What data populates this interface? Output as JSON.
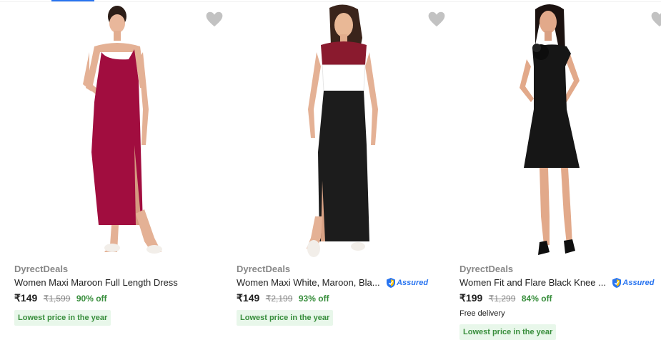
{
  "colors": {
    "accent": "#2874f0",
    "discount": "#388e3c",
    "badge_bg": "#e8f7ea",
    "wishlist": "#c2c2c2"
  },
  "products": [
    {
      "brand": "DyrectDeals",
      "title": "Women Maxi Maroon Full Length Dress",
      "assured": false,
      "price": "₹149",
      "mrp": "₹1,599",
      "discount": "90% off",
      "delivery": "",
      "badge": "Lowest price in the year",
      "wishlist_icon": "heart-icon"
    },
    {
      "brand": "DyrectDeals",
      "title": "Women Maxi White, Maroon, Bla...",
      "assured": true,
      "assured_label": "Assured",
      "price": "₹149",
      "mrp": "₹2,199",
      "discount": "93% off",
      "delivery": "",
      "badge": "Lowest price in the year",
      "wishlist_icon": "heart-icon"
    },
    {
      "brand": "DyrectDeals",
      "title": "Women Fit and Flare Black Knee ...",
      "assured": true,
      "assured_label": "Assured",
      "price": "₹199",
      "mrp": "₹1,299",
      "discount": "84% off",
      "delivery": "Free delivery",
      "badge": "Lowest price in the year",
      "wishlist_icon": "heart-icon"
    }
  ]
}
